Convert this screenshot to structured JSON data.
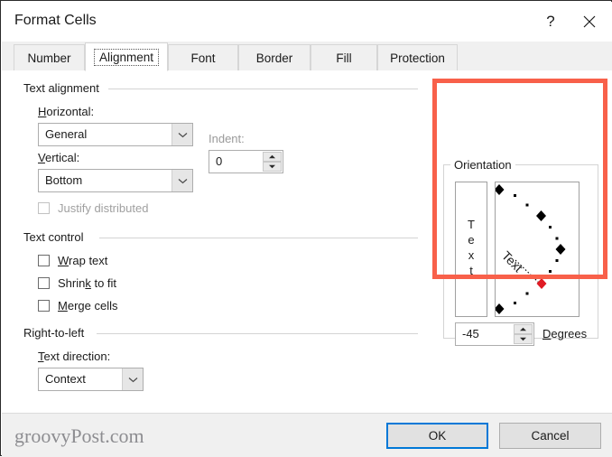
{
  "window": {
    "title": "Format Cells",
    "help_icon": "question-mark-icon",
    "close_icon": "close-icon"
  },
  "tabs": [
    {
      "label": "Number",
      "active": false
    },
    {
      "label": "Alignment",
      "active": true
    },
    {
      "label": "Font",
      "active": false
    },
    {
      "label": "Border",
      "active": false
    },
    {
      "label": "Fill",
      "active": false
    },
    {
      "label": "Protection",
      "active": false
    }
  ],
  "text_alignment": {
    "group_label": "Text alignment",
    "horizontal_label_pre": "H",
    "horizontal_label_post": "orizontal:",
    "horizontal_value": "General",
    "vertical_label_pre": "V",
    "vertical_label_post": "ertical:",
    "vertical_value": "Bottom",
    "justify_distributed_label": "Justify distributed",
    "justify_distributed_checked": false,
    "justify_distributed_enabled": false,
    "indent_label": "Indent:",
    "indent_enabled": false,
    "indent_value": "0"
  },
  "text_control": {
    "group_label": "Text control",
    "items": [
      {
        "label_pre": "W",
        "label_post": "rap text",
        "checked": false
      },
      {
        "label_pre": "Shrin",
        "label_mid": "k",
        "label_post": " to fit",
        "checked": false
      },
      {
        "label_pre": "M",
        "label_post": "erge cells",
        "checked": false
      }
    ]
  },
  "right_to_left": {
    "group_label": "Right-to-left",
    "direction_label_pre": "T",
    "direction_label_post": "ext direction:",
    "direction_value": "Context"
  },
  "orientation": {
    "group_label": "Orientation",
    "vertical_text_preview": "Text",
    "dial_text_label": "Text",
    "degrees_value": "-45",
    "degrees_label_pre": "D",
    "degrees_label_post": "egrees",
    "selected_angle": -45,
    "marker_color": "#e01b24",
    "marker_color_normal": "#000000"
  },
  "footer": {
    "watermark": "groovyPost.com",
    "ok_label": "OK",
    "cancel_label": "Cancel"
  },
  "colors": {
    "highlight_red": "#f8604a",
    "focus_blue": "#0078d7",
    "dialog_bg": "#ffffff",
    "chrome_bg": "#f0f0f0"
  }
}
